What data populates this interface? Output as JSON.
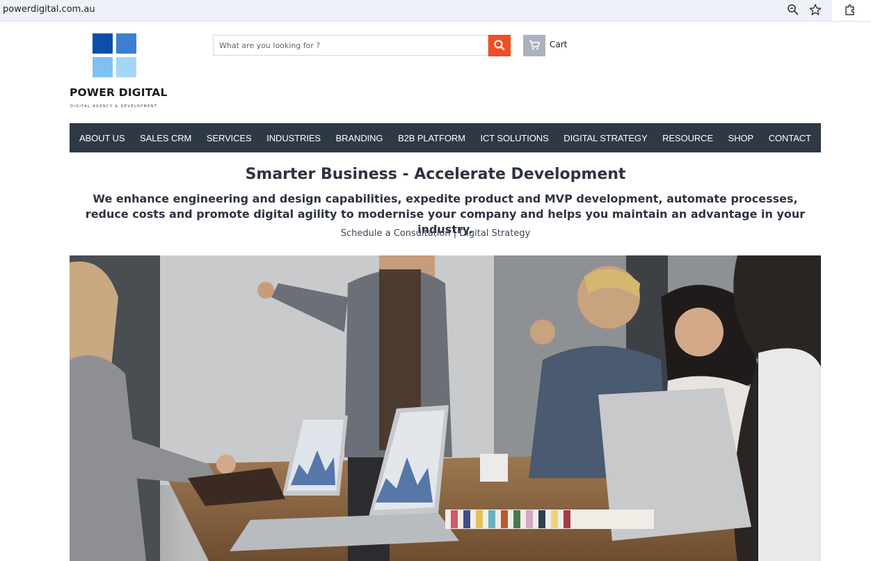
{
  "browser": {
    "url": "powerdigital.com.au"
  },
  "logo": {
    "name": "POWER DIGITAL",
    "tagline": "DIGITAL AGENCY & DEVELOPMENT",
    "colors": [
      "#0a4fa8",
      "#3b7fd0",
      "#7fc1f2",
      "#a6d6f7"
    ]
  },
  "search": {
    "placeholder": "What are you looking for ?",
    "value": "",
    "button_color": "#f04e23"
  },
  "cart": {
    "label": "Cart"
  },
  "nav": {
    "items": [
      "ABOUT US",
      "SALES CRM",
      "SERVICES",
      "INDUSTRIES",
      "BRANDING",
      "B2B PLATFORM",
      "ICT SOLUTIONS",
      "DIGITAL STRATEGY",
      "RESOURCE",
      "SHOP",
      "CONTACT"
    ],
    "background": "#2f3845"
  },
  "hero": {
    "title": "Smarter Business - Accelerate Development",
    "subtitle": "We enhance engineering and design capabilities, expedite product and MVP development, automate processes, reduce costs and promote digital agility to modernise your company and helps you maintain an advantage in your industry.",
    "link1": "Schedule a Consultation",
    "separator": "|",
    "link2": "Digital Strategy"
  }
}
